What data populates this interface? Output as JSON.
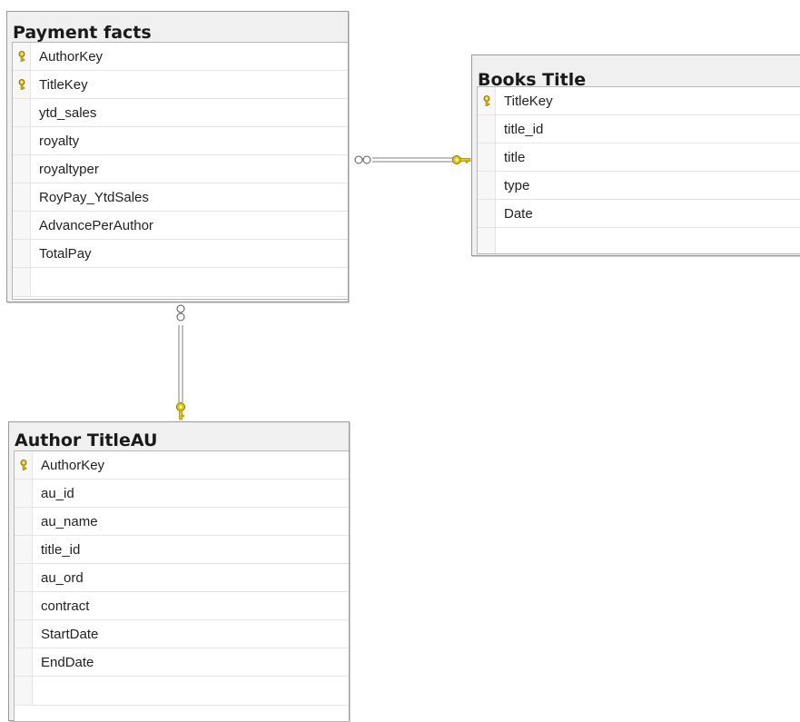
{
  "colors": {
    "key_icon": "#e8c800",
    "connector": "#7f7f7f"
  },
  "tables": {
    "payment_facts": {
      "title": "Payment facts",
      "columns": [
        {
          "name": "AuthorKey",
          "key": true
        },
        {
          "name": "TitleKey",
          "key": true
        },
        {
          "name": "ytd_sales",
          "key": false
        },
        {
          "name": "royalty",
          "key": false
        },
        {
          "name": "royaltyper",
          "key": false
        },
        {
          "name": "RoyPay_YtdSales",
          "key": false
        },
        {
          "name": "AdvancePerAuthor",
          "key": false
        },
        {
          "name": "TotalPay",
          "key": false
        }
      ]
    },
    "books_title": {
      "title": "Books Title",
      "columns": [
        {
          "name": "TitleKey",
          "key": true
        },
        {
          "name": "title_id",
          "key": false
        },
        {
          "name": "title",
          "key": false
        },
        {
          "name": "type",
          "key": false
        },
        {
          "name": "Date",
          "key": false
        }
      ]
    },
    "author_titleau": {
      "title": "Author TitleAU",
      "columns": [
        {
          "name": "AuthorKey",
          "key": true
        },
        {
          "name": "au_id",
          "key": false
        },
        {
          "name": "au_name",
          "key": false
        },
        {
          "name": "title_id",
          "key": false
        },
        {
          "name": "au_ord",
          "key": false
        },
        {
          "name": "contract",
          "key": false
        },
        {
          "name": "StartDate",
          "key": false
        },
        {
          "name": "EndDate",
          "key": false
        }
      ]
    }
  },
  "relationships": [
    {
      "from": "payment_facts",
      "to": "books_title",
      "many_end": "payment_facts",
      "one_end": "books_title"
    },
    {
      "from": "payment_facts",
      "to": "author_titleau",
      "many_end": "payment_facts",
      "one_end": "author_titleau"
    }
  ]
}
